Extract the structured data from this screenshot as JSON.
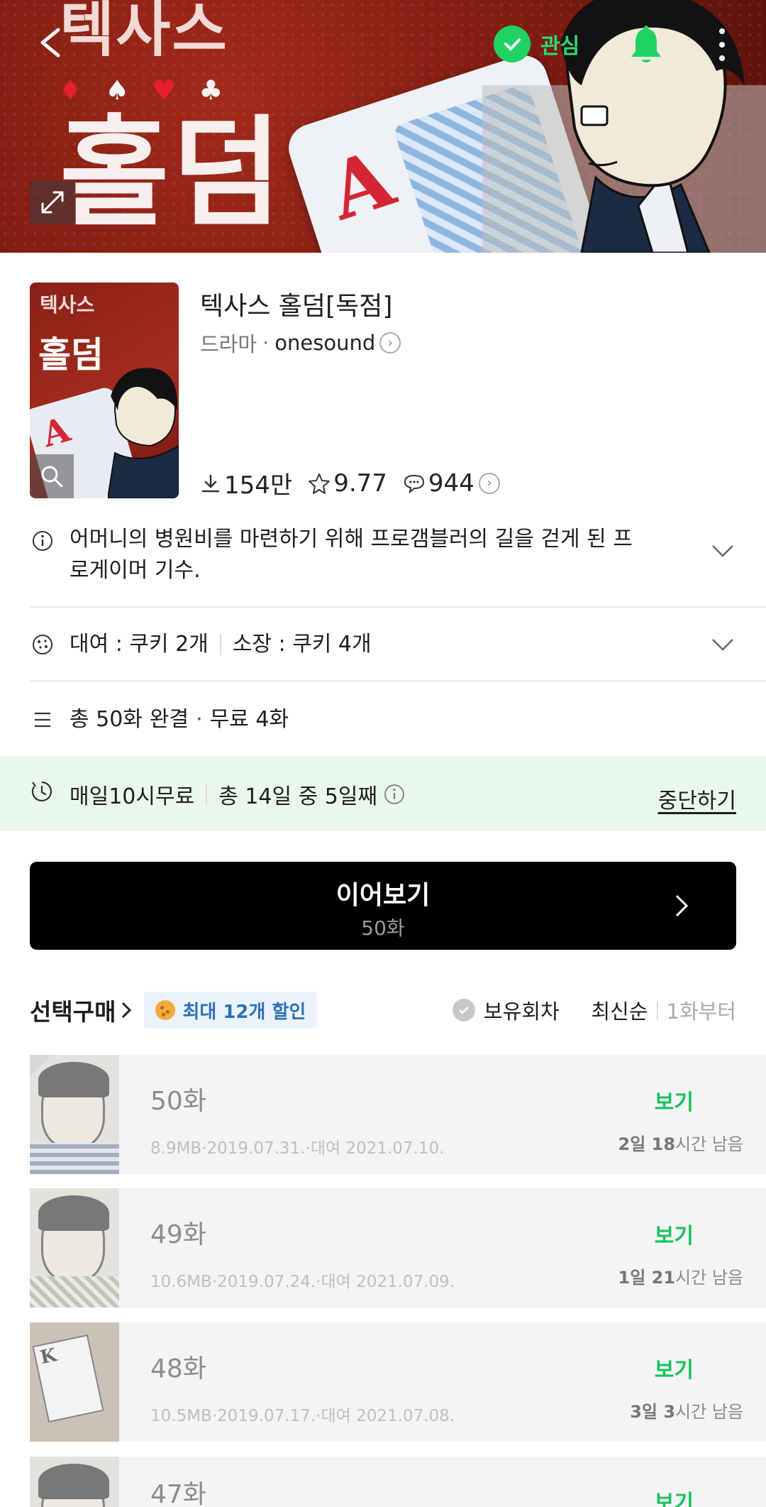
{
  "hero": {
    "title_small": "텍사스",
    "title_big": "홀덤",
    "suits": [
      "♦",
      "♠",
      "♥",
      "♣"
    ],
    "favorite_label": "관심",
    "accent": "#1fd264"
  },
  "info": {
    "thumb_title_small": "텍사스",
    "thumb_title_big": "홀덤",
    "title": "텍사스 홀덤[독점]",
    "genre": "드라마",
    "author": "onesound",
    "downloads": "154만",
    "rating": "9.77",
    "comments": "944"
  },
  "summary": "어머니의 병원비를 마련하기 위해 프로갬블러의 길을 걷게 된 프로게이머 기수.",
  "pricing": {
    "rent": "대여 : 쿠키 2개",
    "own": "소장 : 쿠키 4개"
  },
  "episodes_info": {
    "total": "총 50화",
    "status": "완결",
    "free": "무료 4화"
  },
  "free_pass": {
    "label": "매일10시무료",
    "progress": "총 14일 중 5일째",
    "stop": "중단하기"
  },
  "continue": {
    "label": "이어보기",
    "episode": "50화"
  },
  "list_header": {
    "select_buy": "선택구매",
    "discount": "최대 12개 할인",
    "owned": "보유회차",
    "sort_latest": "최신순",
    "sort_first": "1화부터"
  },
  "episodes": [
    {
      "title": "50화",
      "meta": "8.9MB·2019.07.31.·대여 2021.07.10.",
      "view": "보기",
      "remain_bold": "2일 18",
      "remain_rest": "시간 남음"
    },
    {
      "title": "49화",
      "meta": "10.6MB·2019.07.24.·대여 2021.07.09.",
      "view": "보기",
      "remain_bold": "1일 21",
      "remain_rest": "시간 남음"
    },
    {
      "title": "48화",
      "meta": "10.5MB·2019.07.17.·대여 2021.07.08.",
      "view": "보기",
      "remain_bold": "3일 3",
      "remain_rest": "시간 남음"
    },
    {
      "title": "47화",
      "view": "보기"
    }
  ]
}
